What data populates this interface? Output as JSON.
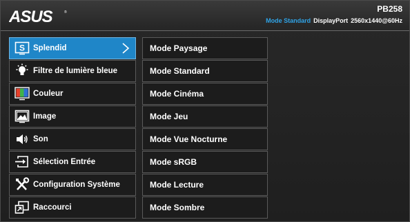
{
  "header": {
    "logo_text": "ASUS",
    "model": "PB258",
    "mode": "Mode Standard",
    "input": "DisplayPort",
    "resolution": "2560x1440@60Hz"
  },
  "menu": {
    "items": [
      {
        "label": "Splendid",
        "icon": "splendid-s-icon",
        "active": true
      },
      {
        "label": "Filtre de lumière bleue",
        "icon": "blue-light-bulb-icon"
      },
      {
        "label": "Couleur",
        "icon": "color-bars-icon"
      },
      {
        "label": "Image",
        "icon": "image-picture-icon"
      },
      {
        "label": "Son",
        "icon": "speaker-icon"
      },
      {
        "label": "Sélection Entrée",
        "icon": "input-arrow-icon"
      },
      {
        "label": "Configuration Système",
        "icon": "wrench-screwdriver-icon"
      },
      {
        "label": "Raccourci",
        "icon": "shortcut-icon"
      }
    ]
  },
  "submenu": {
    "items": [
      "Mode Paysage",
      "Mode Standard",
      "Mode Cinéma",
      "Mode Jeu",
      "Mode Vue Nocturne",
      "Mode sRGB",
      "Mode Lecture",
      "Mode Sombre"
    ]
  },
  "colors": {
    "accent": "#1f86c8",
    "mode_text": "#2fa3e6",
    "item_bg": "#1c1c1c",
    "item_border": "#5a5a5a"
  }
}
